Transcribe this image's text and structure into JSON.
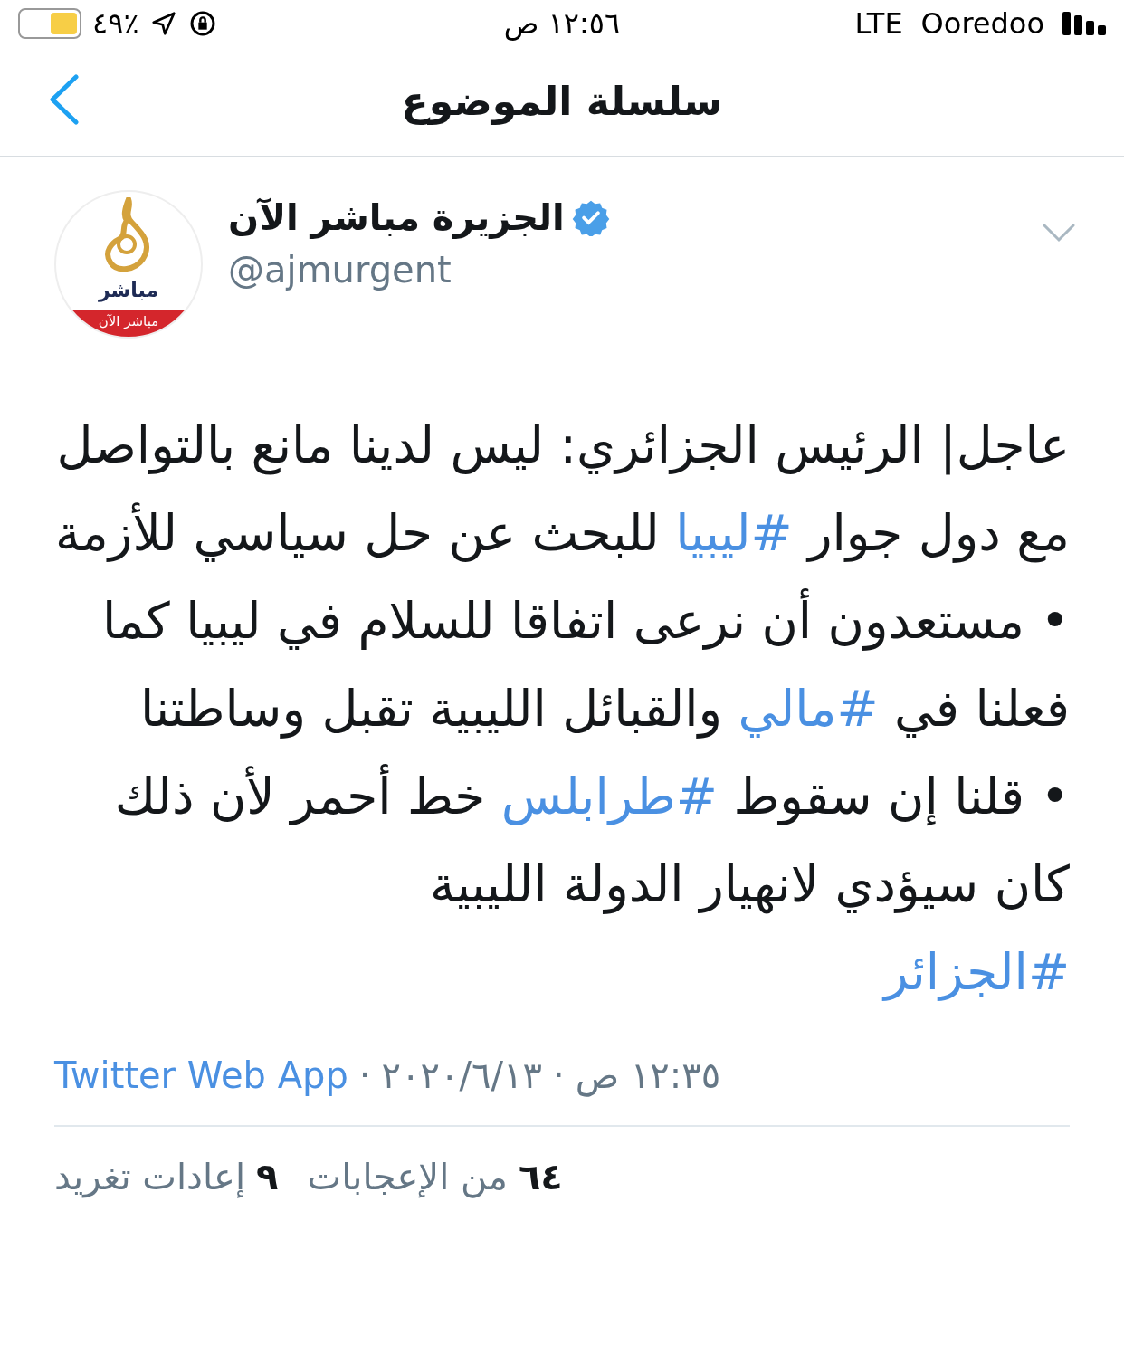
{
  "status_bar": {
    "carrier": "Ooredoo",
    "network": "LTE",
    "time": "١٢:٥٦ ص",
    "battery": "٪٤٩"
  },
  "header": {
    "title": "سلسلة الموضوع"
  },
  "tweet": {
    "author": {
      "name": "الجزيرة مباشر الآن",
      "handle": "@ajmurgent",
      "verified": true,
      "avatar_label": "مباشر",
      "avatar_band": "مباشر الآن"
    },
    "paragraphs": [
      [
        {
          "kind": "text",
          "text": "عاجل| الرئيس الجزائري: ليس لدينا مانع بالتواصل مع دول جوار "
        },
        {
          "kind": "hashtag",
          "text": "#ليبيا"
        },
        {
          "kind": "text",
          "text": " للبحث عن حل سياسي للأزمة"
        }
      ],
      [
        {
          "kind": "text",
          "text": "• مستعدون أن نرعى اتفاقا للسلام في ليبيا كما فعلنا في "
        },
        {
          "kind": "hashtag",
          "text": "#مالي"
        },
        {
          "kind": "text",
          "text": " والقبائل الليبية تقبل وساطتنا"
        }
      ],
      [
        {
          "kind": "text",
          "text": "• قلنا إن سقوط "
        },
        {
          "kind": "hashtag",
          "text": "#طرابلس"
        },
        {
          "kind": "text",
          "text": " خط أحمر لأن ذلك كان سيؤدي لانهيار الدولة الليبية"
        }
      ],
      [
        {
          "kind": "hashtag",
          "text": "#الجزائر"
        }
      ]
    ],
    "separator": "·",
    "time": "١٢:٣٥ ص",
    "date": "٢٠٢٠/٦/١٣",
    "source": "Twitter Web App",
    "stats": [
      {
        "count": "٦٤",
        "label": "من الإعجابات"
      },
      {
        "count": "٩",
        "label": "إعادات تغريد"
      }
    ]
  }
}
